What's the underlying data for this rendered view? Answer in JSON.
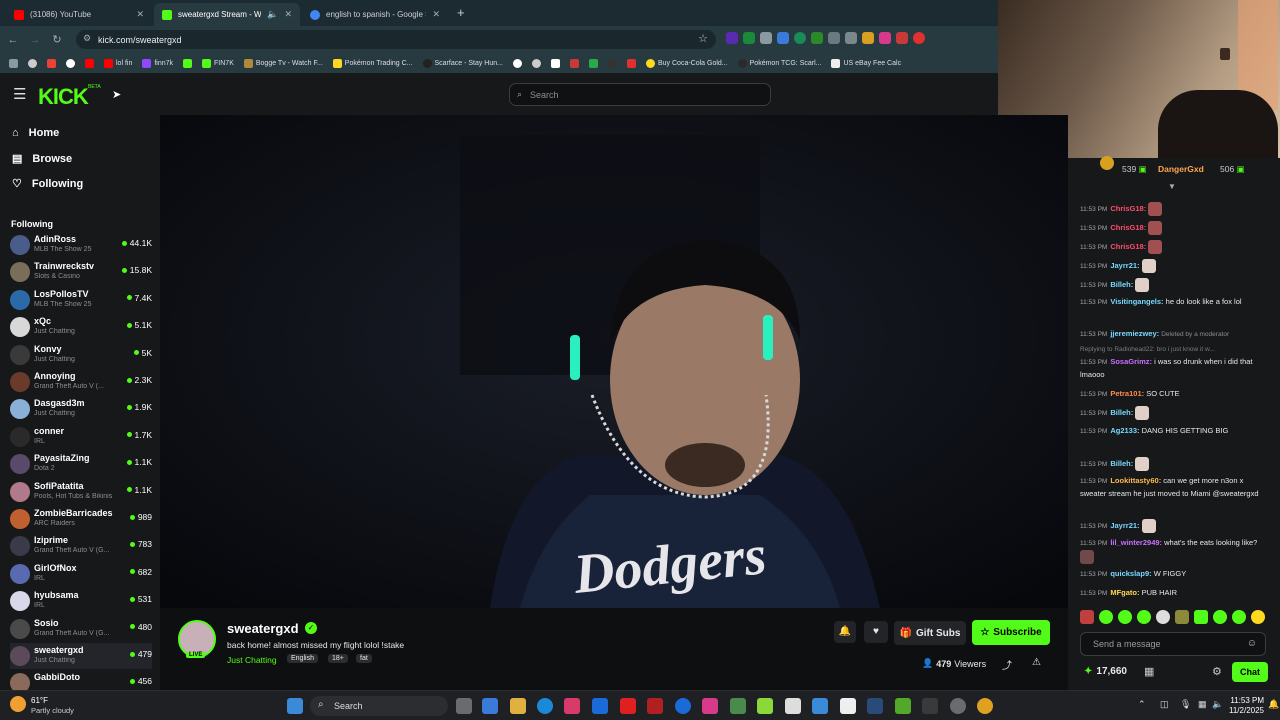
{
  "browser": {
    "tabs": [
      {
        "label": "(31086) YouTube",
        "color": "#ff0000"
      },
      {
        "label": "sweatergxd Stream - Watch",
        "color": "#53fc18"
      },
      {
        "label": "english to spanish - Google Se",
        "color": "#4285f4"
      }
    ],
    "new_tab": "+",
    "url": "kick.com/sweatergxd",
    "bookmarks": [
      "lol fin",
      "finn7k",
      "FIN7K",
      "Bogge Tv - Watch F...",
      "Pokémon Trading C...",
      "Scarface - Stay Hun...",
      "Buy Coca-Cola Gold...",
      "Pokémon TCG: Scarl...",
      "US eBay Fee Calc"
    ]
  },
  "header": {
    "logo": "KICK",
    "logo_badge": "BETA",
    "search_placeholder": "Search"
  },
  "sidebar": {
    "nav": [
      {
        "label": "Home",
        "icon": "home-icon"
      },
      {
        "label": "Browse",
        "icon": "browse-icon"
      },
      {
        "label": "Following",
        "icon": "heart-icon"
      }
    ],
    "following_heading": "Following",
    "following": [
      {
        "name": "AdinRoss",
        "category": "MLB The Show 25",
        "viewers": "44.1K",
        "color": "#4a5d8a"
      },
      {
        "name": "Trainwreckstv",
        "category": "Slots & Casino",
        "viewers": "15.8K",
        "color": "#7a6d5a"
      },
      {
        "name": "LosPollosTV",
        "category": "MLB The Show 25",
        "viewers": "7.4K",
        "color": "#2b6aa8"
      },
      {
        "name": "xQc",
        "category": "Just Chatting",
        "viewers": "5.1K",
        "color": "#d8d8d8"
      },
      {
        "name": "Konvy",
        "category": "Just Chatting",
        "viewers": "5K",
        "color": "#3a3a3a"
      },
      {
        "name": "Annoying",
        "category": "Grand Theft Auto V (...",
        "viewers": "2.3K",
        "color": "#6a3a2a"
      },
      {
        "name": "Dasgasd3m",
        "category": "Just Chatting",
        "viewers": "1.9K",
        "color": "#8ab0d8"
      },
      {
        "name": "conner",
        "category": "IRL",
        "viewers": "1.7K",
        "color": "#2a2a2a"
      },
      {
        "name": "PayasitaZing",
        "category": "Dota 2",
        "viewers": "1.1K",
        "color": "#5a4a6a"
      },
      {
        "name": "SofiPatatita",
        "category": "Pools, Hot Tubs & Bikinis",
        "viewers": "1.1K",
        "color": "#b07a8a"
      },
      {
        "name": "ZombieBarricades",
        "category": "ARC Raiders",
        "viewers": "989",
        "color": "#c06030"
      },
      {
        "name": "Iziprime",
        "category": "Grand Theft Auto V (G...",
        "viewers": "783",
        "color": "#3a3a4a"
      },
      {
        "name": "GirlOfNox",
        "category": "IRL",
        "viewers": "682",
        "color": "#5a6ab0"
      },
      {
        "name": "hyubsama",
        "category": "IRL",
        "viewers": "531",
        "color": "#d8d8e8"
      },
      {
        "name": "Sosio",
        "category": "Grand Theft Auto V (G...",
        "viewers": "480",
        "color": "#4a4a4a"
      },
      {
        "name": "sweatergxd",
        "category": "Just Chatting",
        "viewers": "479",
        "color": "#5a4a5a"
      },
      {
        "name": "GabbiDoto",
        "category": "",
        "viewers": "456",
        "color": "#8a6a5a"
      }
    ]
  },
  "stream": {
    "channel": "sweatergxd",
    "title": "back home! almost missed my flight lolol !stake",
    "category": "Just Chatting",
    "tags": [
      "English",
      "18+",
      "fat"
    ],
    "viewers": "479",
    "viewers_label": "Viewers",
    "live_badge": "LIVE",
    "gift_subs": "Gift Subs",
    "subscribe": "Subscribe",
    "shirt_text": "Dodgers"
  },
  "chat": {
    "leaders": [
      {
        "name": "",
        "points": "539"
      },
      {
        "name": "DangerGxd",
        "points": "506"
      }
    ],
    "messages": [
      {
        "time": "11:53 PM",
        "user": "ChrisG18:",
        "text": "",
        "color": "#ff4d6d",
        "emote": "#a05050"
      },
      {
        "time": "11:53 PM",
        "user": "ChrisG18:",
        "text": "",
        "color": "#ff4d6d",
        "emote": "#a05050"
      },
      {
        "time": "11:53 PM",
        "user": "ChrisG18:",
        "text": "",
        "color": "#ff4d6d",
        "emote": "#a05050"
      },
      {
        "time": "11:53 PM",
        "user": "Jayrr21:",
        "text": "",
        "color": "#7ad8ff",
        "emote": "#e0d0c8"
      },
      {
        "time": "11:53 PM",
        "user": "Billeh:",
        "text": "",
        "color": "#7ad8ff",
        "emote": "#e0d0c8"
      },
      {
        "time": "11:53 PM",
        "user": "Visitingangels:",
        "text": "he do look like a fox lol",
        "color": "#7ad8ff",
        "emote": ""
      },
      {
        "time": "11:53 PM",
        "user": "jjeremiezwey:",
        "text": "Deleted by a moderator",
        "color": "#7ad8ff",
        "emote": ""
      },
      {
        "time": "11:53 PM",
        "user": "SosaGrimz:",
        "text": "i was so drunk when i did that lmaooo",
        "color": "#c870ff",
        "emote": "",
        "reply": "Replying to Radiohead22: bro i just know it w..."
      },
      {
        "time": "11:53 PM",
        "user": "Petra101:",
        "text": "SO CUTE",
        "color": "#ff8a4d",
        "emote": ""
      },
      {
        "time": "11:53 PM",
        "user": "Billeh:",
        "text": "",
        "color": "#7ad8ff",
        "emote": "#e0d0c8"
      },
      {
        "time": "11:53 PM",
        "user": "Ag2133:",
        "text": "DANG HIS GETTING BIG",
        "color": "#7ad8ff",
        "emote": ""
      },
      {
        "time": "11:53 PM",
        "user": "Billeh:",
        "text": "",
        "color": "#7ad8ff",
        "emote": "#e0d0c8"
      },
      {
        "time": "11:53 PM",
        "user": "Lookittasty60:",
        "text": "can we get more n3on x sweater stream he just moved to Miami @sweatergxd",
        "color": "#ffb84d",
        "emote": ""
      },
      {
        "time": "11:53 PM",
        "user": "Jayrr21:",
        "text": "",
        "color": "#7ad8ff",
        "emote": "#e0d0c8"
      },
      {
        "time": "11:53 PM",
        "user": "lil_winter2949:",
        "text": "what's the eats looking like?",
        "color": "#c870ff",
        "emote": "#704a4a"
      },
      {
        "time": "11:53 PM",
        "user": "quickslap9:",
        "text": "W FIGGY",
        "color": "#7ad8ff",
        "emote": ""
      },
      {
        "time": "11:53 PM",
        "user": "MFgato:",
        "text": "PUB HAIR",
        "color": "#ffd84d",
        "emote": ""
      }
    ],
    "input_placeholder": "Send a message",
    "points": "17,660",
    "chat_button": "Chat"
  },
  "taskbar": {
    "weather_temp": "61°F",
    "weather_desc": "Partly cloudy",
    "search": "Search",
    "time": "11:53 PM",
    "date": "11/2/2025"
  }
}
